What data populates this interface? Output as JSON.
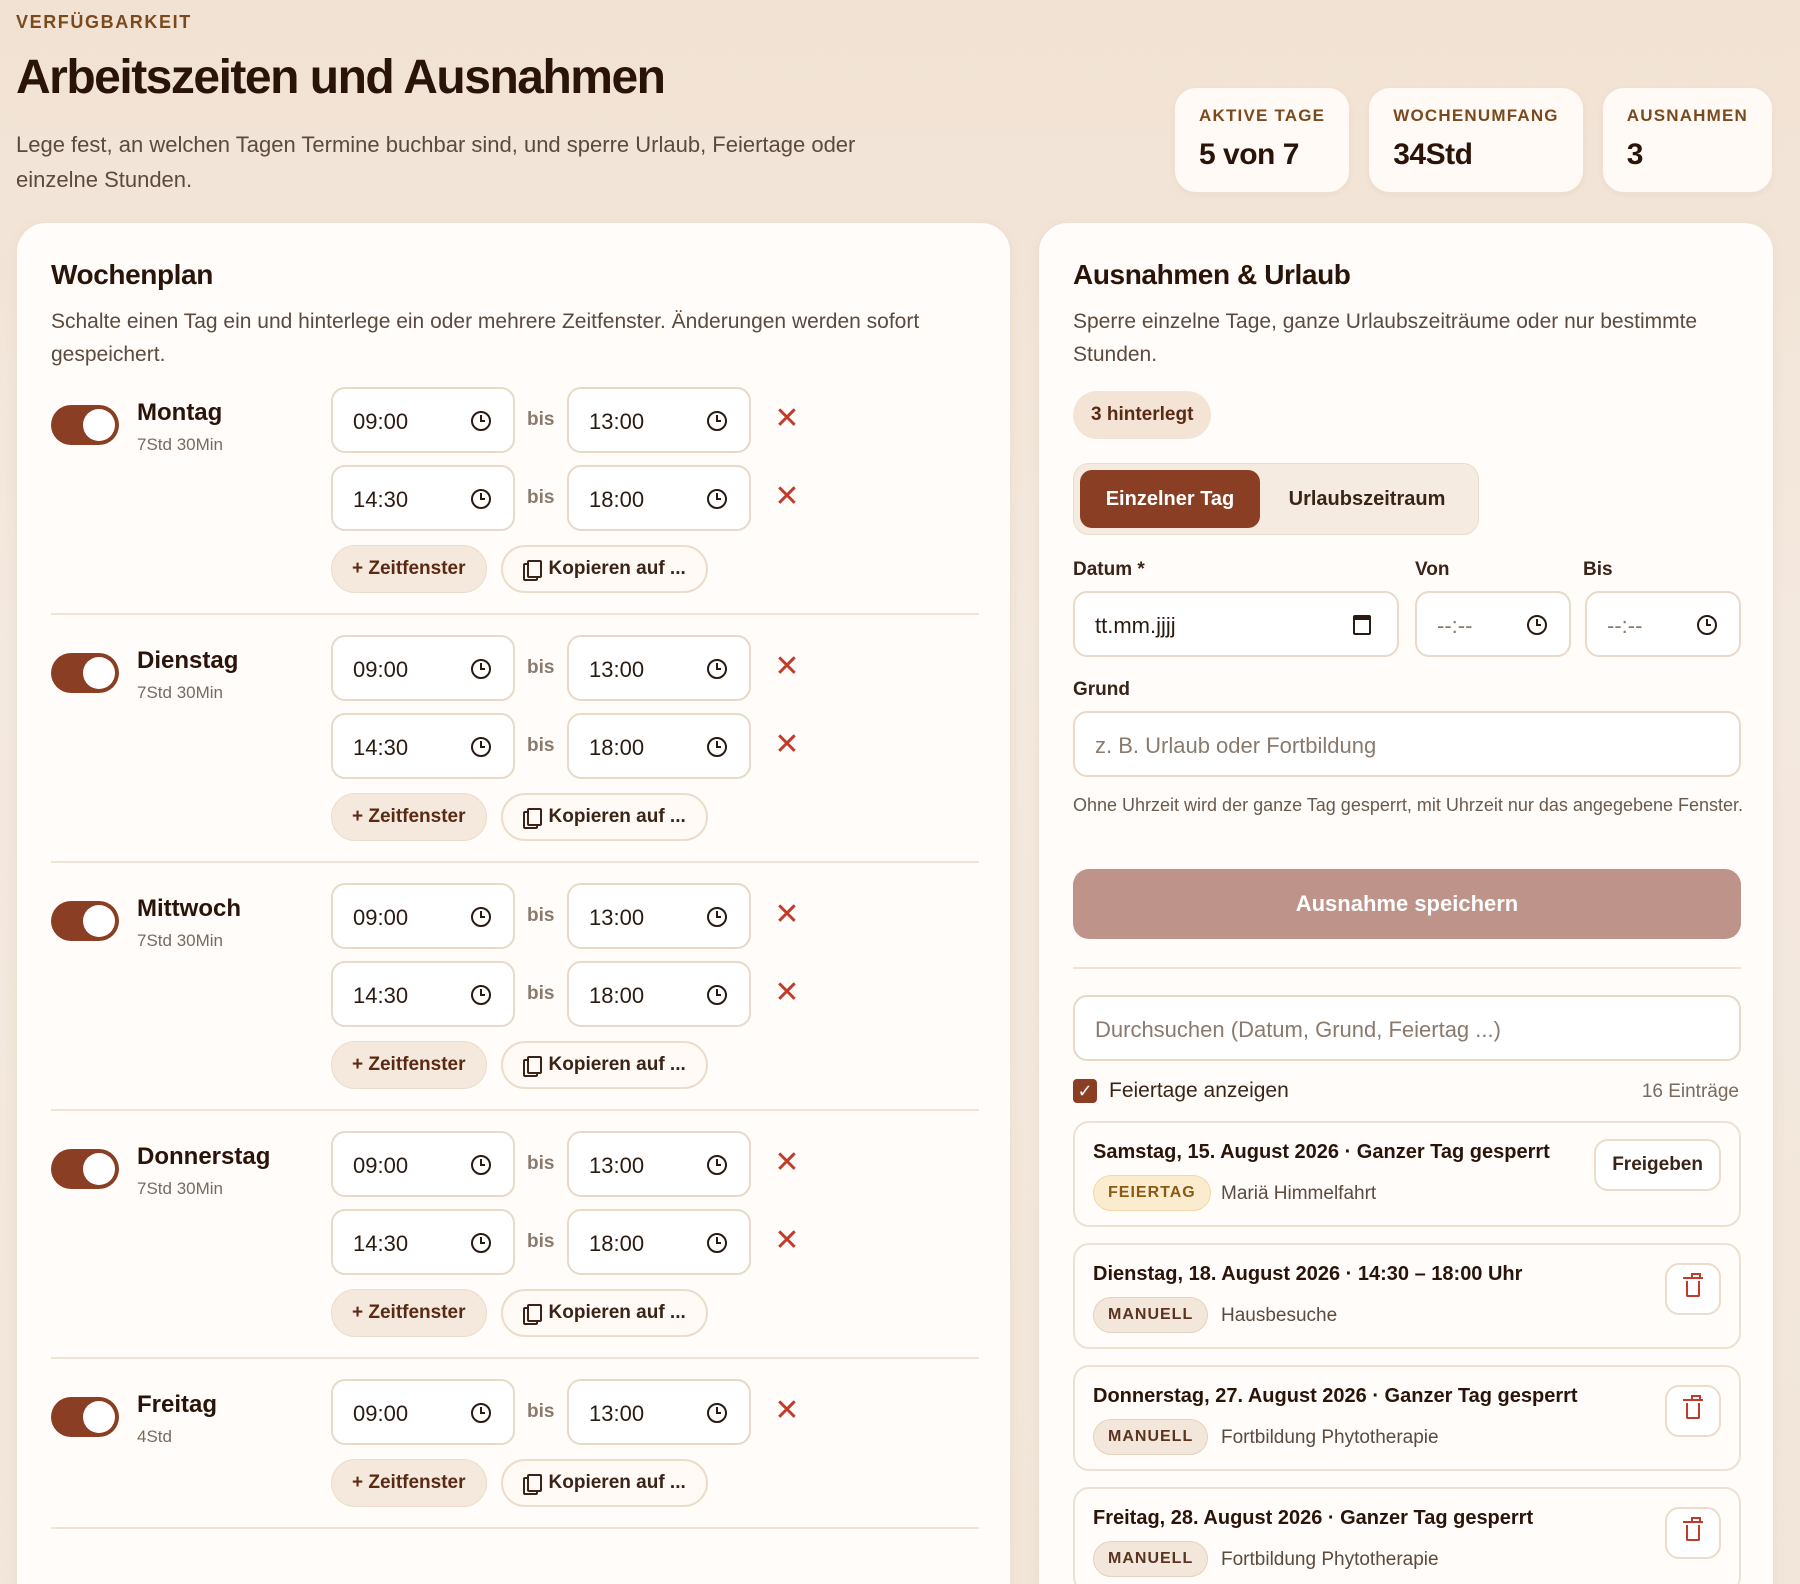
{
  "header": {
    "eyebrow": "VERFÜGBARKEIT",
    "title": "Arbeitszeiten und Ausnahmen",
    "subtitle": "Lege fest, an welchen Tagen Termine buchbar sind, und sperre Urlaub, Feiertage oder einzelne Stunden."
  },
  "stats": [
    {
      "label": "AKTIVE TAGE",
      "value": "5 von 7"
    },
    {
      "label": "WOCHENUMFANG",
      "value": "34Std"
    },
    {
      "label": "AUSNAHMEN",
      "value": "3"
    }
  ],
  "weekplan": {
    "title": "Wochenplan",
    "description": "Schalte einen Tag ein und hinterlege ein oder mehrere Zeitfenster. Änderungen werden sofort gespeichert.",
    "bis_label": "bis",
    "remove_glyph": "✕",
    "add_label": "+ Zeitfenster",
    "copy_label": "Kopieren auf ...",
    "days": [
      {
        "name": "Montag",
        "hours": "7Std 30Min",
        "enabled": true,
        "slots": [
          {
            "from": "09:00",
            "to": "13:00"
          },
          {
            "from": "14:30",
            "to": "18:00"
          }
        ]
      },
      {
        "name": "Dienstag",
        "hours": "7Std 30Min",
        "enabled": true,
        "slots": [
          {
            "from": "09:00",
            "to": "13:00"
          },
          {
            "from": "14:30",
            "to": "18:00"
          }
        ]
      },
      {
        "name": "Mittwoch",
        "hours": "7Std 30Min",
        "enabled": true,
        "slots": [
          {
            "from": "09:00",
            "to": "13:00"
          },
          {
            "from": "14:30",
            "to": "18:00"
          }
        ]
      },
      {
        "name": "Donnerstag",
        "hours": "7Std 30Min",
        "enabled": true,
        "slots": [
          {
            "from": "09:00",
            "to": "13:00"
          },
          {
            "from": "14:30",
            "to": "18:00"
          }
        ]
      },
      {
        "name": "Freitag",
        "hours": "4Std",
        "enabled": true,
        "slots": [
          {
            "from": "09:00",
            "to": "13:00"
          }
        ]
      }
    ]
  },
  "exceptions": {
    "title": "Ausnahmen & Urlaub",
    "description": "Sperre einzelne Tage, ganze Urlaubszeiträume oder nur bestimmte Stunden.",
    "count_badge": "3 hinterlegt",
    "tabs": {
      "active": "Einzelner Tag",
      "inactive": "Urlaubszeitraum"
    },
    "form": {
      "date_label": "Datum *",
      "date_placeholder": "tt.mm.jjjj",
      "from_label": "Von",
      "from_placeholder": "--:--",
      "to_label": "Bis",
      "to_placeholder": "--:--",
      "reason_label": "Grund",
      "reason_placeholder": "z. B. Urlaub oder Fortbildung",
      "hint": "Ohne Uhrzeit wird der ganze Tag gesperrt, mit Uhrzeit nur das angegebene Fenster.",
      "save_label": "Ausnahme speichern"
    },
    "search_placeholder": "Durchsuchen (Datum, Grund, Feiertag ...)",
    "show_holidays_label": "Feiertage anzeigen",
    "show_holidays_checked": true,
    "check_glyph": "✓",
    "entries_count": "16 Einträge",
    "entries": [
      {
        "title": "Samstag, 15. August 2026 · Ganzer Tag gesperrt",
        "tag": "FEIERTAG",
        "reason": "Mariä Himmelfahrt",
        "action": "Freigeben"
      },
      {
        "title": "Dienstag, 18. August 2026 · 14:30 – 18:00 Uhr",
        "tag": "MANUELL",
        "reason": "Hausbesuche",
        "action": "delete"
      },
      {
        "title": "Donnerstag, 27. August 2026 · Ganzer Tag gesperrt",
        "tag": "MANUELL",
        "reason": "Fortbildung Phytotherapie",
        "action": "delete"
      },
      {
        "title": "Freitag, 28. August 2026 · Ganzer Tag gesperrt",
        "tag": "MANUELL",
        "reason": "Fortbildung Phytotherapie",
        "action": "delete"
      }
    ]
  }
}
